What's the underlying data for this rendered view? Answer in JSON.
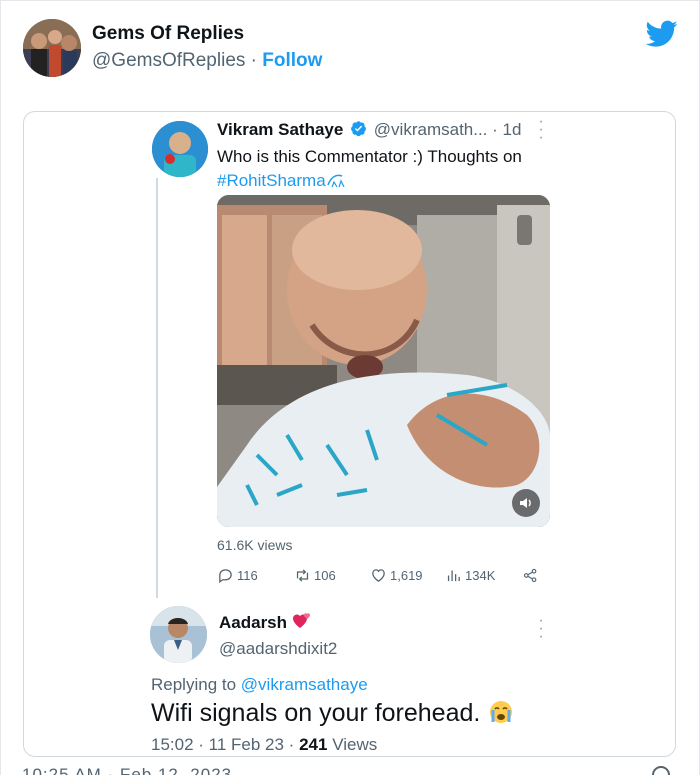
{
  "header": {
    "account_name": "Gems Of Replies",
    "account_handle": "@GemsOfReplies",
    "separator": "·",
    "follow_label": "Follow",
    "brand_color": "#1d9bf0",
    "bird_icon": "twitter-bird-icon"
  },
  "quoted_tweet": {
    "author_name": "Vikram Sathaye",
    "author_handle": "@vikramsath...",
    "time": "· 1d",
    "text": "Who is this Commentator :) Thoughts on",
    "hashtag": "#RohitSharma",
    "views": "61.6K views",
    "stats": {
      "replies": "116",
      "retweets": "106",
      "likes": "1,619",
      "views": "134K"
    }
  },
  "reply": {
    "author_name": "Aadarsh",
    "author_handle": "@aadarshdixit2",
    "replying_prefix": "Replying to",
    "replying_to": "@vikramsathaye",
    "text": "Wifi signals on your forehead.",
    "time": "15:02 · 11 Feb 23 ·",
    "views_count": "241",
    "views_label": "Views"
  },
  "footer_cut": "10:25 AM · Feb 12, 2023"
}
